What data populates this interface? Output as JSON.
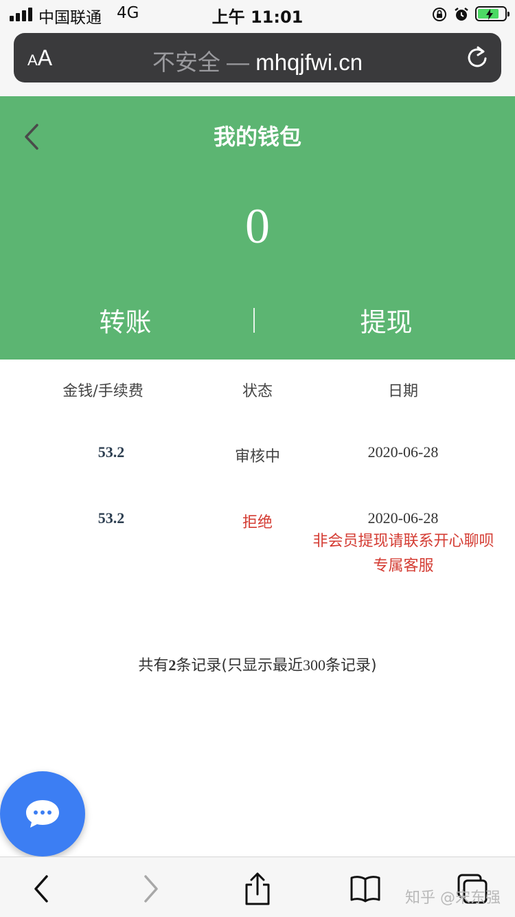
{
  "status_bar": {
    "carrier": "中国联通",
    "network": "4G",
    "time": "上午 11:01"
  },
  "browser": {
    "aa_small": "A",
    "aa_big": "A",
    "url_insecure_label": "不安全",
    "url_separator": " — ",
    "url_domain": "mhqjfwi.cn"
  },
  "wallet": {
    "title": "我的钱包",
    "balance": "0",
    "transfer_label": "转账",
    "withdraw_label": "提现"
  },
  "records": {
    "columns": [
      "金钱/手续费",
      "状态",
      "日期"
    ],
    "rows": [
      {
        "amount": "53.2",
        "status": "审核中",
        "date": "2020-06-28"
      },
      {
        "amount": "53.2",
        "status": "拒绝",
        "date": "2020-06-28",
        "note": "非会员提现请联系开心聊呗专属客服"
      }
    ],
    "summary_prefix": "共有",
    "summary_count": "2",
    "summary_middle": "条记录(只显示最近",
    "summary_limit": "300",
    "summary_suffix": "条记录)"
  },
  "watermark": "知乎 @宋东强",
  "colors": {
    "header_green": "#5cb572",
    "rejected_red": "#d43c33",
    "chat_blue": "#3c7ef3"
  },
  "icons": {
    "back": "chevron-left-icon",
    "reload": "reload-icon",
    "chat": "chat-bubble-icon",
    "share": "share-icon",
    "bookmarks": "book-icon",
    "tabs": "tabs-icon"
  }
}
